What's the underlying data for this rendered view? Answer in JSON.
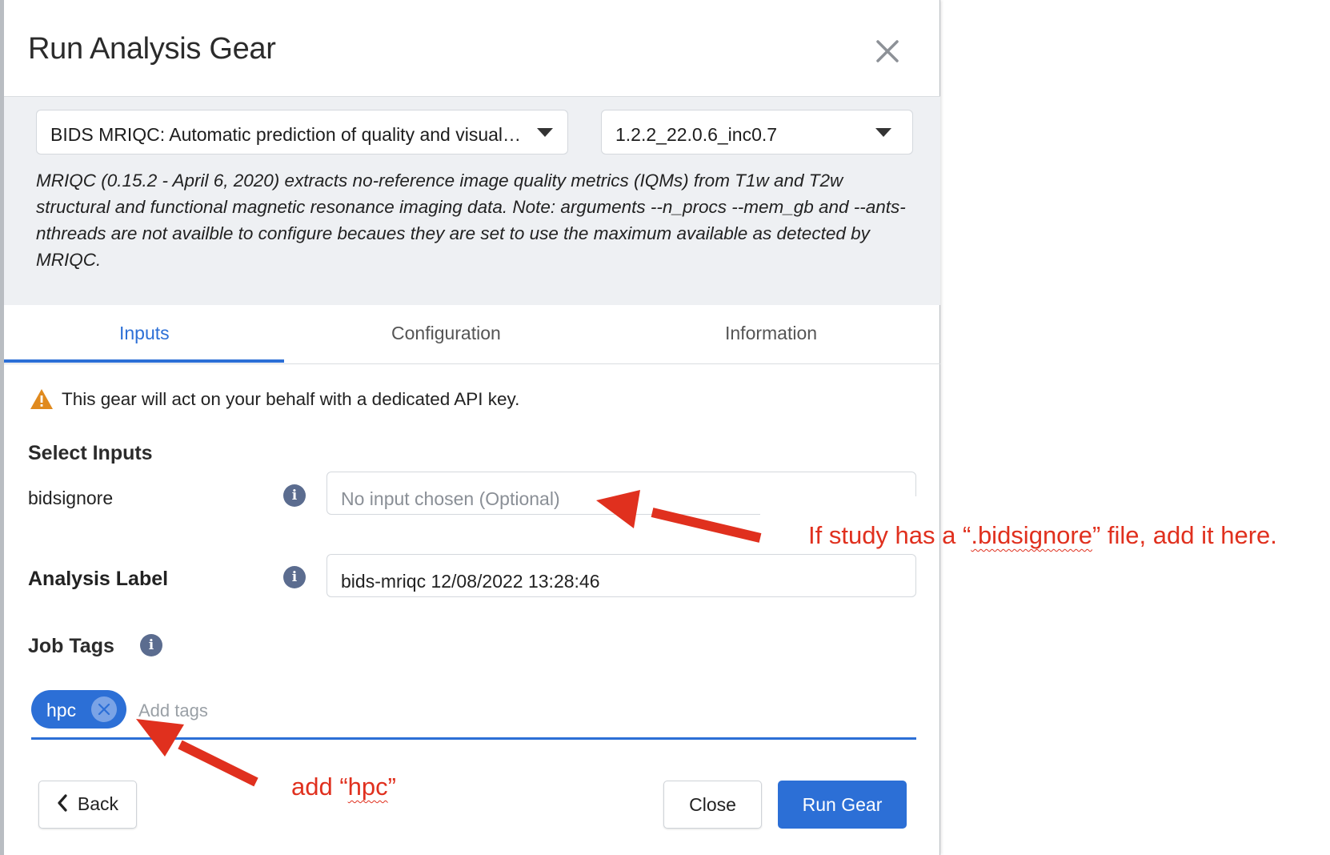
{
  "dialog": {
    "title": "Run Analysis Gear"
  },
  "gear": {
    "selected_gear": "BIDS MRIQC: Automatic prediction of quality and visual reporting of MRI scans",
    "selected_version": "1.2.2_22.0.6_inc0.7",
    "description": "MRIQC (0.15.2 - April 6, 2020) extracts no-reference image quality metrics (IQMs) from T1w and T2w structural and functional magnetic resonance imaging data. Note: arguments --n_procs --mem_gb and --ants-nthreads are not availble to configure becaues they are set to use the maximum available as detected by MRIQC."
  },
  "tabs": [
    {
      "label": "Inputs",
      "active": true
    },
    {
      "label": "Configuration",
      "active": false
    },
    {
      "label": "Information",
      "active": false
    }
  ],
  "warning": {
    "icon": "warning-triangle-icon",
    "text": "This gear will act on your behalf with a dedicated API key."
  },
  "inputs": {
    "section_title": "Select Inputs",
    "bidsignore_label": "bidsignore",
    "bidsignore_placeholder": "No input chosen (Optional)",
    "analysis_label_title": "Analysis Label",
    "analysis_label_value": "bids-mriqc 12/08/2022 13:28:46"
  },
  "job_tags": {
    "title": "Job Tags",
    "tags": [
      "hpc"
    ],
    "placeholder": "Add tags"
  },
  "buttons": {
    "back": "Back",
    "close": "Close",
    "run": "Run Gear"
  },
  "annotations": {
    "bidsignore_note_pre": "If study has a “",
    "bidsignore_note_word": ".bidsignore",
    "bidsignore_note_post": "” file, add it here.",
    "hpc_note_pre": "add “",
    "hpc_note_word": "hpc",
    "hpc_note_post": "”"
  },
  "colors": {
    "accent": "#2c6fd6",
    "annotation": "#e0301e",
    "panel_bg": "#eef0f3",
    "warning": "#e08a1e"
  }
}
